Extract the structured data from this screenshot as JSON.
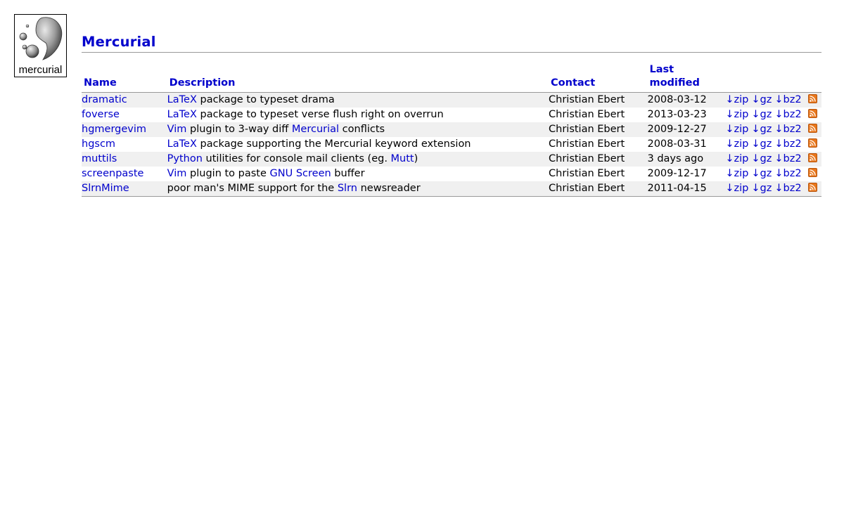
{
  "logo": {
    "text": "mercurial"
  },
  "header": {
    "title": "Mercurial"
  },
  "table": {
    "columns": {
      "name": "Name",
      "description": "Description",
      "contact": "Contact",
      "last_modified": "Last modified"
    },
    "rows": [
      {
        "name": "dramatic",
        "desc": [
          {
            "t": "LaTeX",
            "link": true
          },
          {
            "t": " package to typeset drama",
            "link": false
          }
        ],
        "contact": "Christian Ebert",
        "date": "2008-03-12"
      },
      {
        "name": "foverse",
        "desc": [
          {
            "t": "LaTeX",
            "link": true
          },
          {
            "t": " package to typeset verse flush right on overrun",
            "link": false
          }
        ],
        "contact": "Christian Ebert",
        "date": "2013-03-23"
      },
      {
        "name": "hgmergevim",
        "desc": [
          {
            "t": "Vim",
            "link": true
          },
          {
            "t": " plugin to 3-way diff ",
            "link": false
          },
          {
            "t": "Mercurial",
            "link": true
          },
          {
            "t": " conflicts",
            "link": false
          }
        ],
        "contact": "Christian Ebert",
        "date": "2009-12-27"
      },
      {
        "name": "hgscm",
        "desc": [
          {
            "t": "LaTeX",
            "link": true
          },
          {
            "t": " package supporting the Mercurial keyword extension",
            "link": false
          }
        ],
        "contact": "Christian Ebert",
        "date": "2008-03-31"
      },
      {
        "name": "muttils",
        "desc": [
          {
            "t": "Python",
            "link": true
          },
          {
            "t": " utilities for console mail clients (eg. ",
            "link": false
          },
          {
            "t": "Mutt",
            "link": true
          },
          {
            "t": ")",
            "link": false
          }
        ],
        "contact": "Christian Ebert",
        "date": "3 days ago"
      },
      {
        "name": "screenpaste",
        "desc": [
          {
            "t": "Vim",
            "link": true
          },
          {
            "t": " plugin to paste ",
            "link": false
          },
          {
            "t": "GNU Screen",
            "link": true
          },
          {
            "t": " buffer",
            "link": false
          }
        ],
        "contact": "Christian Ebert",
        "date": "2009-12-17"
      },
      {
        "name": "SlrnMime",
        "desc": [
          {
            "t": "poor man's MIME support for the ",
            "link": false
          },
          {
            "t": "Slrn",
            "link": true
          },
          {
            "t": " newsreader",
            "link": false
          }
        ],
        "contact": "Christian Ebert",
        "date": "2011-04-15"
      }
    ],
    "archives": [
      "↓zip",
      "↓gz",
      "↓bz2"
    ],
    "rss_icon": "rss-feed-icon"
  },
  "colors": {
    "link": "#0000cc",
    "row_alt": "#f0f0f0",
    "rss": "#e8771c"
  }
}
